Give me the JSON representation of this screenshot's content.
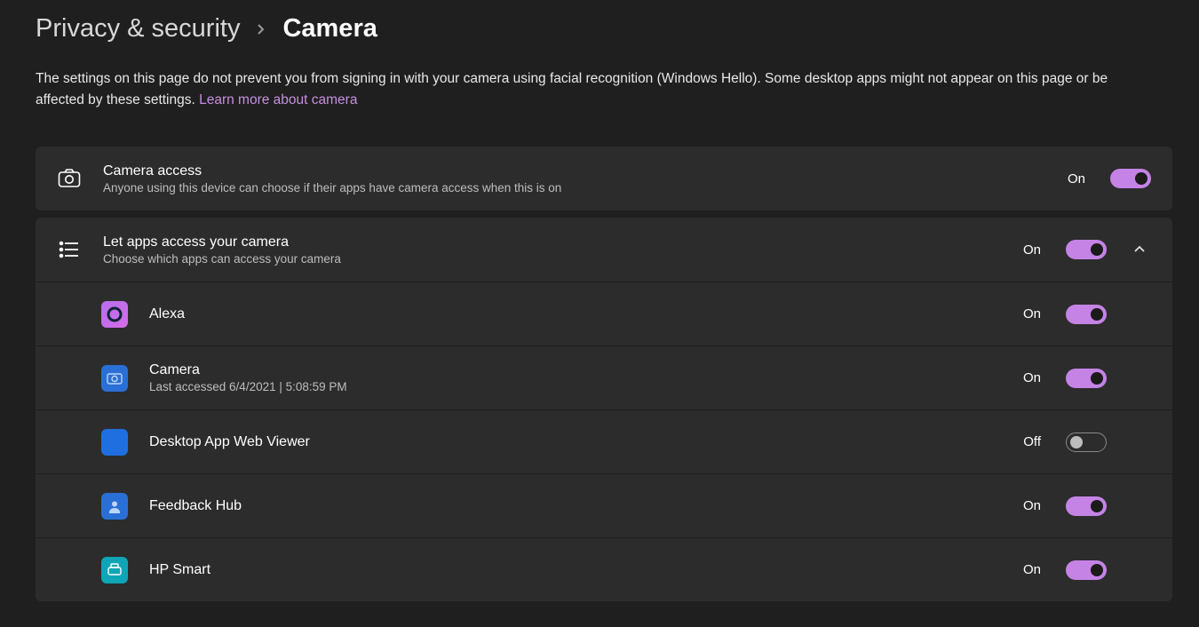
{
  "breadcrumb": {
    "parent": "Privacy & security",
    "current": "Camera"
  },
  "description_text": "The settings on this page do not prevent you from signing in with your camera using facial recognition (Windows Hello). Some desktop apps might not appear on this page or be affected by these settings.  ",
  "description_link": "Learn more about camera",
  "camera_access": {
    "title": "Camera access",
    "subtitle": "Anyone using this device can choose if their apps have camera access when this is on",
    "state": "On"
  },
  "apps_access": {
    "title": "Let apps access your camera",
    "subtitle": "Choose which apps can access your camera",
    "state": "On"
  },
  "apps": [
    {
      "name": "Alexa",
      "state": "On",
      "subtitle": ""
    },
    {
      "name": "Camera",
      "state": "On",
      "subtitle": "Last accessed 6/4/2021  |  5:08:59 PM"
    },
    {
      "name": "Desktop App Web Viewer",
      "state": "Off",
      "subtitle": ""
    },
    {
      "name": "Feedback Hub",
      "state": "On",
      "subtitle": ""
    },
    {
      "name": "HP Smart",
      "state": "On",
      "subtitle": ""
    }
  ]
}
